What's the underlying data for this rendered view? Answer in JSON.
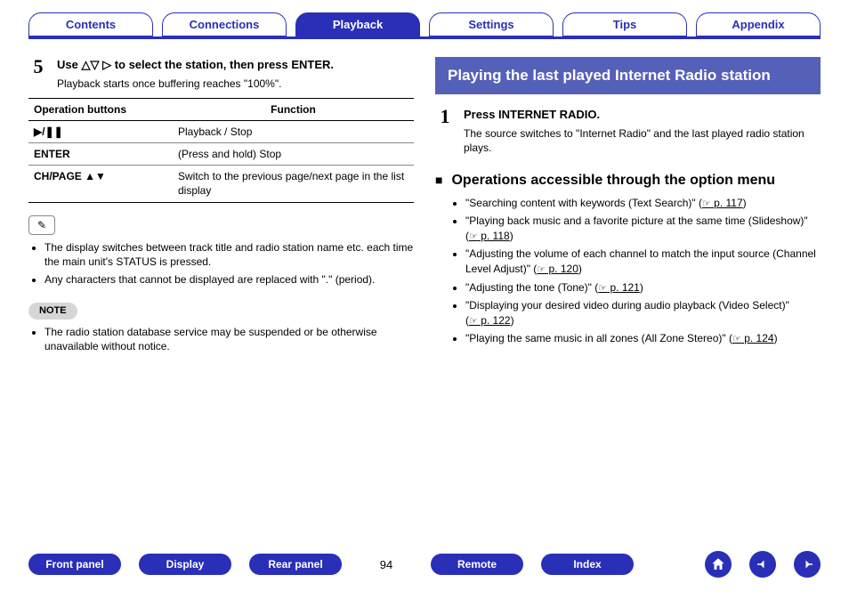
{
  "tabs": {
    "items": [
      {
        "label": "Contents",
        "active": false
      },
      {
        "label": "Connections",
        "active": false
      },
      {
        "label": "Playback",
        "active": true
      },
      {
        "label": "Settings",
        "active": false
      },
      {
        "label": "Tips",
        "active": false
      },
      {
        "label": "Appendix",
        "active": false
      }
    ]
  },
  "left": {
    "step_num": "5",
    "step_title_pre": "Use ",
    "step_title_symbols": "△▽ ▷",
    "step_title_post": " to select the station, then press ENTER.",
    "step_sub": "Playback starts once buffering reaches \"100%\".",
    "table": {
      "h1": "Operation buttons",
      "h2": "Function",
      "rows": [
        {
          "b": "▶/❚❚",
          "f": "Playback / Stop"
        },
        {
          "b": "ENTER",
          "f": "(Press and hold) Stop"
        },
        {
          "b": "CH/PAGE ▲▼",
          "f": "Switch to the previous page/next page in the list display"
        }
      ]
    },
    "tip1": "The display switches between track title and radio station name etc. each time the main unit's STATUS is pressed.",
    "tip2": "Any characters that cannot be displayed are replaced with \".\" (period).",
    "note_label": "NOTE",
    "note1": "The radio station database service may be suspended or be otherwise unavailable without notice."
  },
  "right": {
    "section_title": "Playing the last played Internet Radio station",
    "step_num": "1",
    "step_title": "Press INTERNET RADIO.",
    "step_sub": "The source switches to \"Internet Radio\" and the last played radio station plays.",
    "ops_title": "Operations accessible through the option menu",
    "ops": [
      {
        "text": "\"Searching content with keywords (Text Search)\" (",
        "ref": " p. 117",
        "tail": ")"
      },
      {
        "text": "\"Playing back music and a favorite picture at the same time (Slideshow)\" (",
        "ref": " p. 118",
        "tail": ")"
      },
      {
        "text": "\"Adjusting the volume of each channel to match the input source (Channel Level Adjust)\" (",
        "ref": " p. 120",
        "tail": ")"
      },
      {
        "text": "\"Adjusting the tone (Tone)\" (",
        "ref": " p. 121",
        "tail": ")"
      },
      {
        "text": "\"Displaying your desired video during audio playback (Video Select)\" (",
        "ref": " p. 122",
        "tail": ")"
      },
      {
        "text": "\"Playing the same music in all zones (All Zone Stereo)\" (",
        "ref": " p. 124",
        "tail": ")"
      }
    ]
  },
  "bottom": {
    "pills": [
      "Front panel",
      "Display",
      "Rear panel"
    ],
    "page": "94",
    "pills2": [
      "Remote",
      "Index"
    ]
  },
  "icons": {
    "pencil": "✎",
    "hand": "☞"
  }
}
